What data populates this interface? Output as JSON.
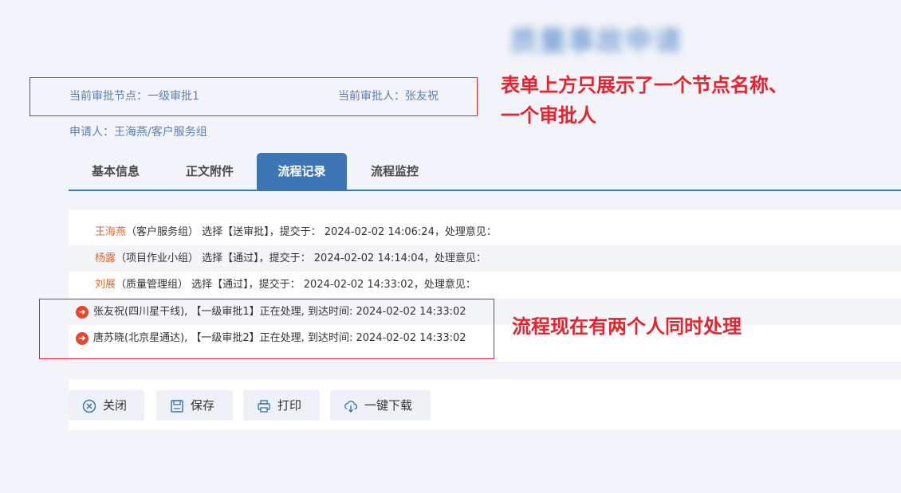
{
  "header": {
    "title": "质量事故申请",
    "current_node_label": "当前审批节点：一级审批1",
    "current_approver_label": "当前审批人：张友祝",
    "applicant_label": "申请人：王海燕/客户服务组"
  },
  "annotations": {
    "top_line1": "表单上方只展示了一个节点名称、",
    "top_line2": "一个审批人",
    "process_note": "流程现在有两个人同时处理"
  },
  "tabs": [
    {
      "label": "基本信息",
      "active": false
    },
    {
      "label": "正文附件",
      "active": false
    },
    {
      "label": "流程记录",
      "active": true
    },
    {
      "label": "流程监控",
      "active": false
    }
  ],
  "log": [
    {
      "name": "王海燕",
      "rest": "（客户服务组） 选择【送审批】，提交于： 2024-02-02 14:06:24，处理意见："
    },
    {
      "name": "杨露",
      "rest": "（项目作业小组） 选择【通过】，提交于： 2024-02-02 14:14:04，处理意见："
    },
    {
      "name": "刘展",
      "rest": "（质量管理组） 选择【通过】，提交于： 2024-02-02 14:33:02，处理意见："
    }
  ],
  "processing": [
    {
      "text": "张友祝(四川星干线), 【一级审批1】正在处理, 到达时间: 2024-02-02 14:33:02"
    },
    {
      "text": "唐苏晓(北京星通达), 【一级审批2】正在处理, 到达时间: 2024-02-02 14:33:02"
    }
  ],
  "buttons": {
    "close": "关闭",
    "save": "保存",
    "print": "打印",
    "download": "一键下载"
  },
  "colors": {
    "accent": "#3e75b5",
    "annotation": "#e8222c",
    "name_highlight": "#e2672b",
    "label_blue": "#5b7fb0"
  }
}
